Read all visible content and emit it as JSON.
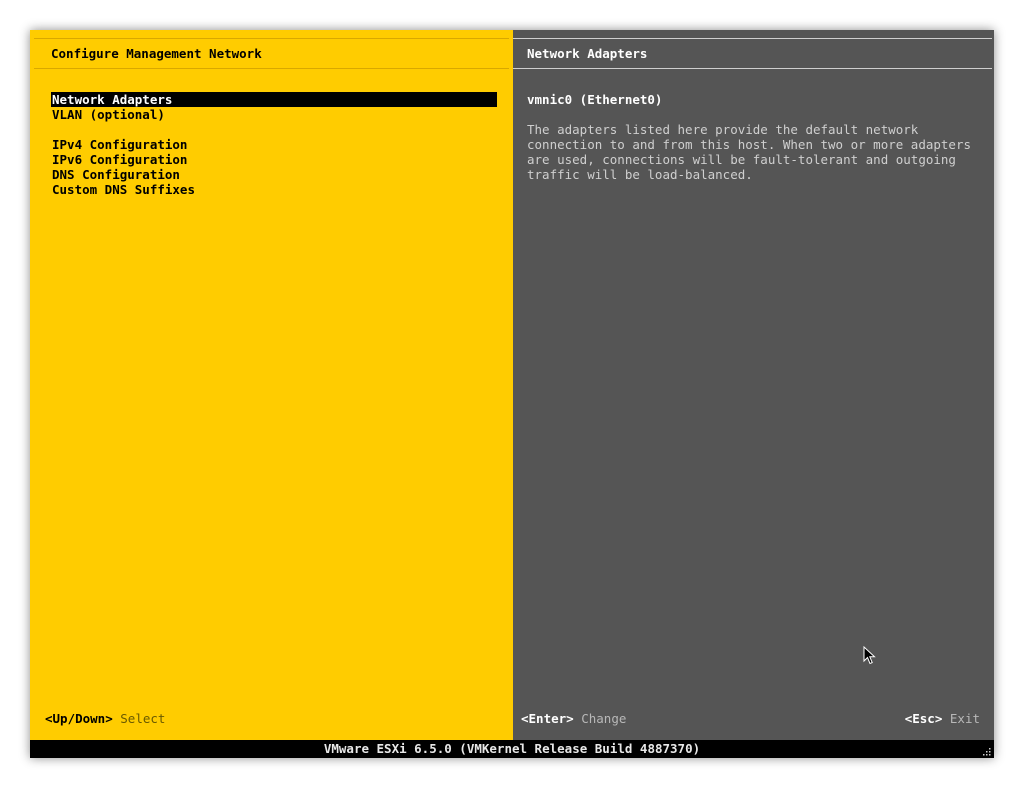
{
  "left_panel": {
    "title": "Configure Management Network",
    "menu": [
      {
        "label": "Network Adapters",
        "selected": true
      },
      {
        "label": "VLAN (optional)",
        "selected": false
      },
      {
        "label": "IPv4 Configuration",
        "selected": false
      },
      {
        "label": "IPv6 Configuration",
        "selected": false
      },
      {
        "label": "DNS Configuration",
        "selected": false
      },
      {
        "label": "Custom DNS Suffixes",
        "selected": false
      }
    ],
    "footer": {
      "key": "<Up/Down>",
      "action": "Select"
    }
  },
  "right_panel": {
    "title": "Network Adapters",
    "adapter": "vmnic0 (Ethernet0)",
    "description": [
      "The adapters listed here provide the default network",
      "connection to and from this host. When two or more adapters",
      "are used, connections will be fault-tolerant and outgoing",
      "traffic will be load-balanced."
    ],
    "footer_change": {
      "key": "<Enter>",
      "action": "Change"
    },
    "footer_exit": {
      "key": "<Esc>",
      "action": "Exit"
    }
  },
  "status_bar": {
    "text": "VMware ESXi 6.5.0 (VMKernel Release Build 4887370)"
  },
  "icons": {
    "pointer": "mouse-pointer-icon",
    "grip": "resize-grip-icon"
  },
  "colors": {
    "left_background": "#ffcc00",
    "right_background": "#555555",
    "selection": "#000000",
    "status_bar": "#000000"
  }
}
